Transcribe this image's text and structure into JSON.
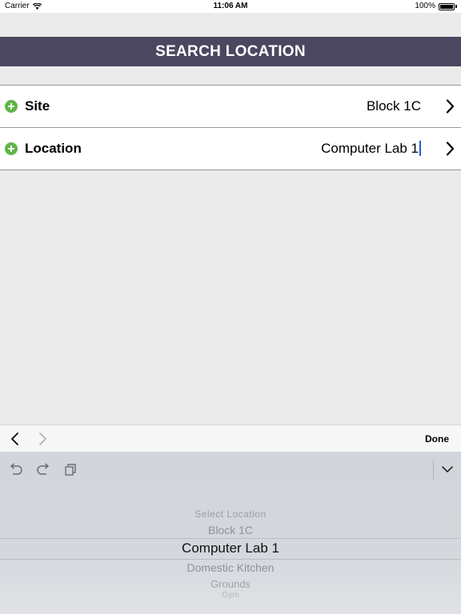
{
  "status_bar": {
    "carrier": "Carrier",
    "time": "11:06 AM",
    "battery": "100%"
  },
  "header": {
    "title": "SEARCH LOCATION"
  },
  "form": {
    "rows": [
      {
        "label": "Site",
        "value": "Block 1C",
        "icon": "plus-circle-icon"
      },
      {
        "label": "Location",
        "value": "Computer Lab 1",
        "icon": "plus-circle-icon"
      }
    ]
  },
  "accessory": {
    "done_label": "Done"
  },
  "picker": {
    "options": [
      "Select Location",
      "Block 1C",
      "Computer Lab 1",
      "Domestic Kitchen",
      "Grounds",
      "Gym"
    ],
    "selected": "Computer Lab 1"
  },
  "colors": {
    "header_bg": "#4b4760",
    "plus_icon": "#5fb548",
    "background": "#ebebeb"
  }
}
